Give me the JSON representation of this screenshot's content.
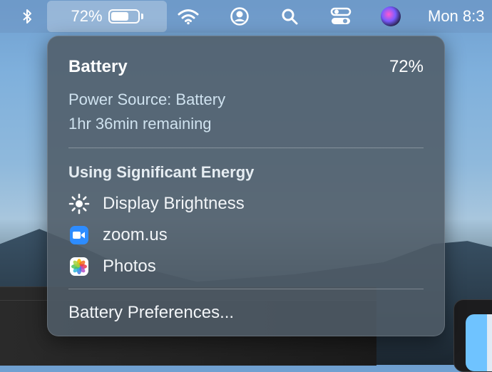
{
  "menubar": {
    "battery_percent": "72%",
    "battery_level": 0.72,
    "clock": "Mon 8:3",
    "icons": [
      "bluetooth-icon",
      "wifi-icon",
      "user-icon",
      "search-icon",
      "control-center-icon",
      "siri-icon"
    ]
  },
  "popover": {
    "title": "Battery",
    "percent": "72%",
    "power_source": "Power Source: Battery",
    "remaining": "1hr 36min remaining",
    "energy_header": "Using Significant Energy",
    "energy_items": [
      {
        "label": "Display Brightness",
        "icon": "sun-icon"
      },
      {
        "label": "zoom.us",
        "icon": "zoom-icon"
      },
      {
        "label": "Photos",
        "icon": "photos-icon"
      }
    ],
    "preferences": "Battery Preferences..."
  },
  "colors": {
    "popover_bg": "#505c68",
    "zoom_blue": "#2d8cff",
    "menubar_highlight": "rgba(255,255,255,0.28)"
  }
}
